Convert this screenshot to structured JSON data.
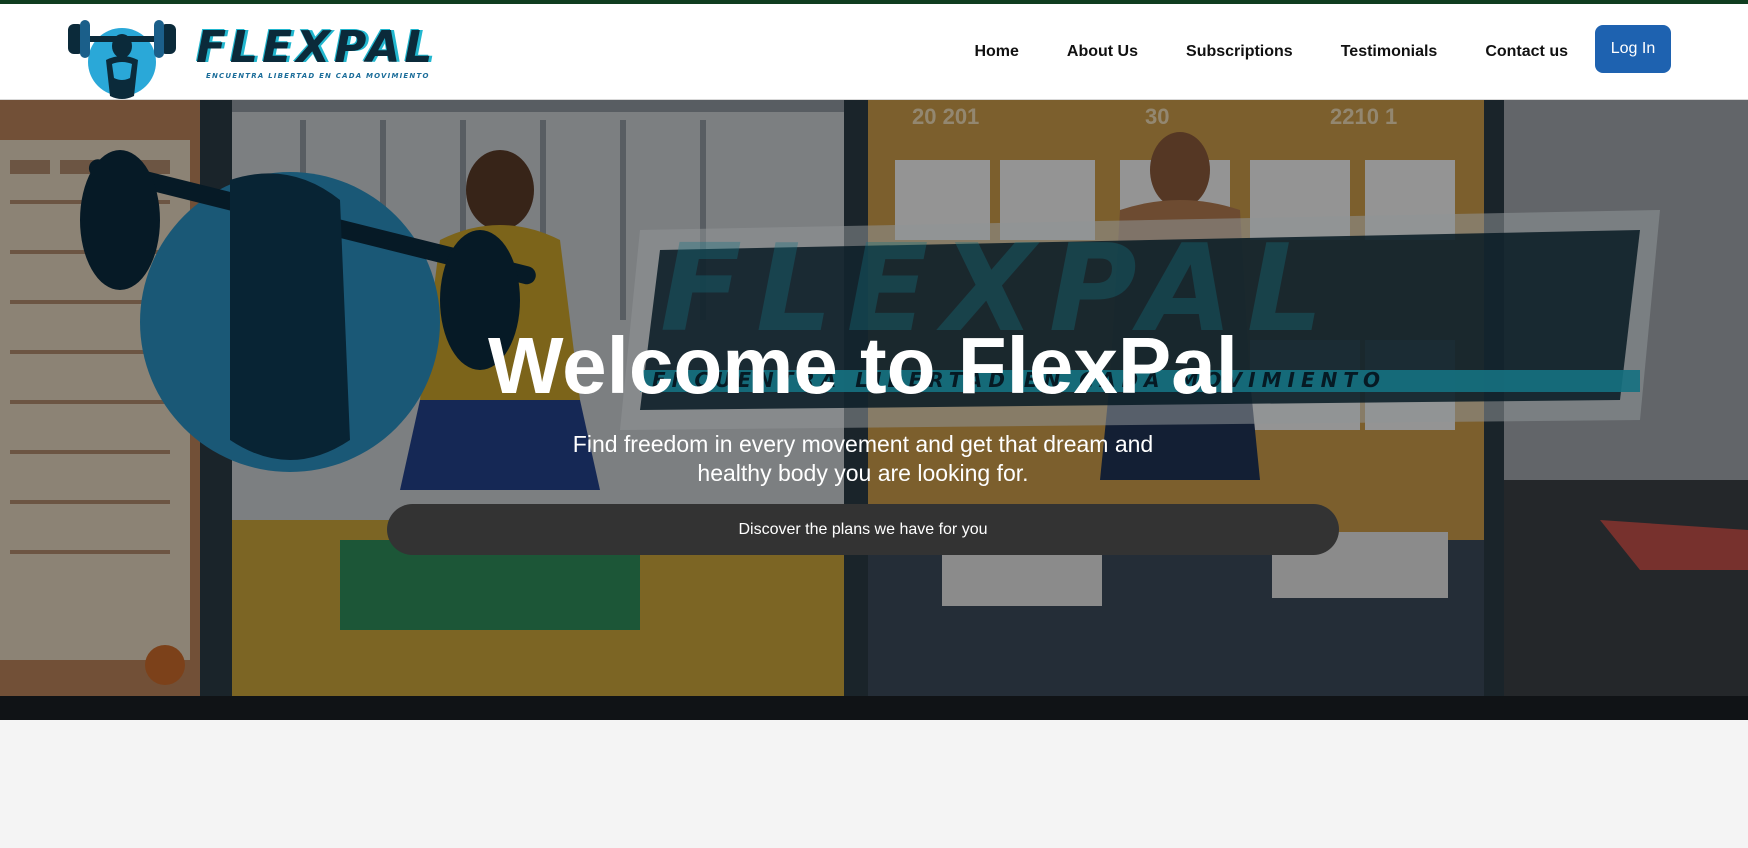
{
  "brand": {
    "name": "FLEXPAL",
    "tagline": "Encuentra libertad en cada movimiento"
  },
  "nav": {
    "items": [
      "Home",
      "About Us",
      "Subscriptions",
      "Testimonials",
      "Contact us"
    ],
    "login_label": "Log In"
  },
  "hero": {
    "title": "Welcome to FlexPal",
    "subtitle": "Find freedom in every movement and get that dream and healthy body you are looking for.",
    "cta_label": "Discover the plans we have for you",
    "background_logo": "FLEXPAL",
    "background_tagline": "ENCUENTRA LIBERTAD EN CADA MOVIMIENTO",
    "calendar_numbers": [
      "20 201",
      "30",
      "2210 1"
    ]
  },
  "colors": {
    "accent": "#1e62b0",
    "brand_teal": "#22b7cf",
    "brand_navy": "#0b2a3a",
    "cta_bg": "#333333"
  },
  "icons": {
    "logo_emblem": "weightlifter-emblem-icon"
  }
}
